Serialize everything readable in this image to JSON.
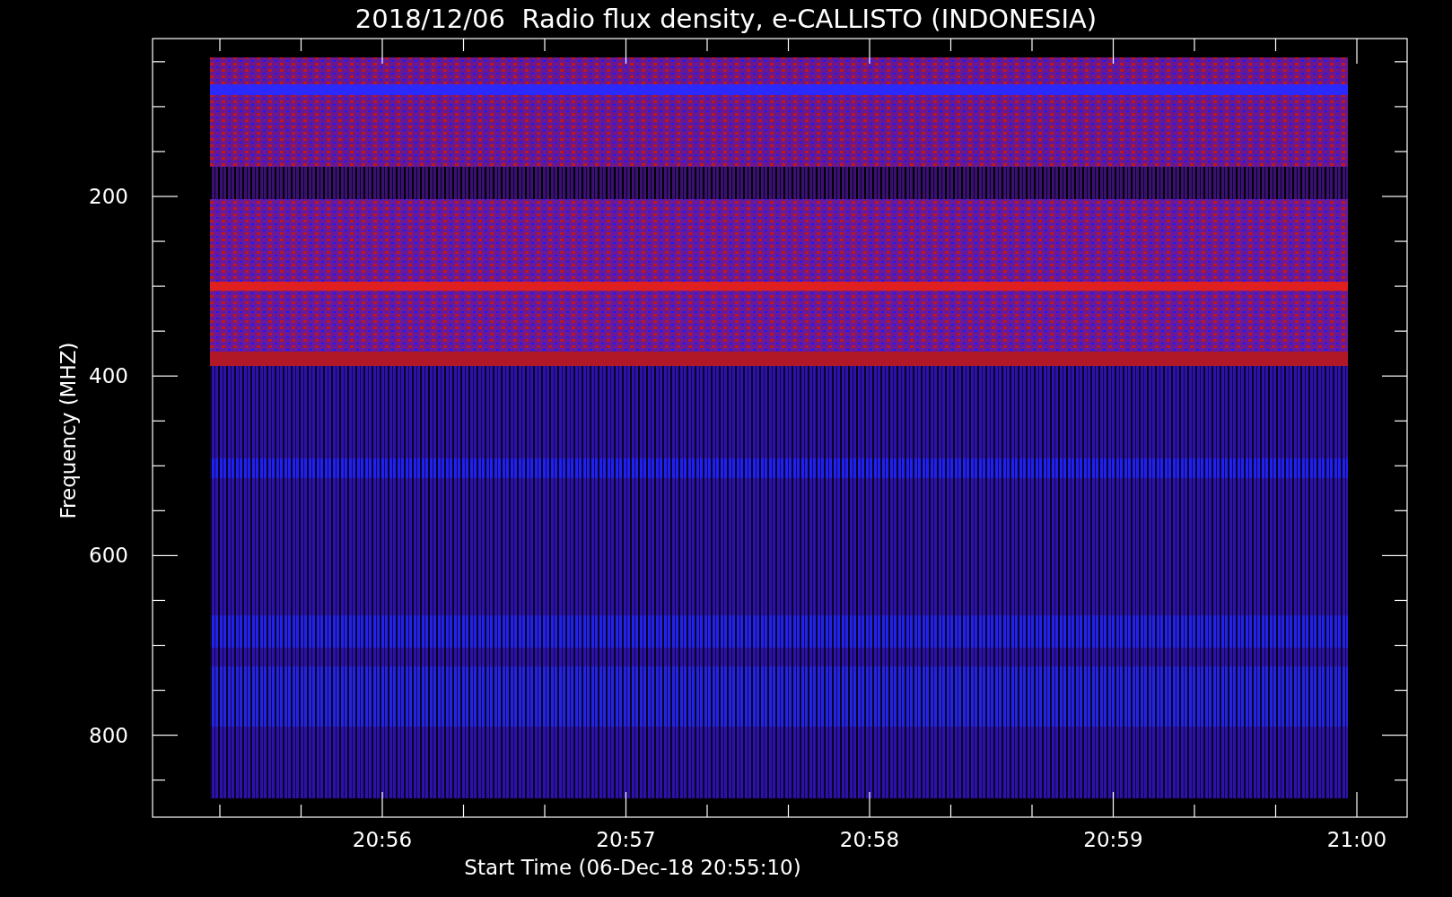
{
  "title": "2018/12/06  Radio flux density, e-CALLISTO (INDONESIA)",
  "plot": {
    "y_label": "Frequency (MHZ)",
    "x_label": "Start Time (06-Dec-18 20:55:10)",
    "y_ticks": [
      "200",
      "400",
      "600",
      "800"
    ],
    "x_ticks": [
      "20:56",
      "20:57",
      "20:58",
      "20:59",
      "21:00"
    ],
    "image": {
      "kind": "picture"
    }
  }
}
